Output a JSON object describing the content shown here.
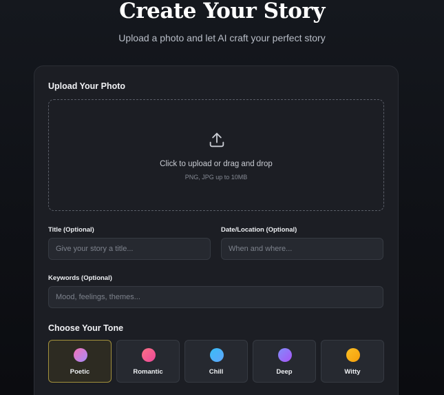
{
  "header": {
    "title": "Create Your Story",
    "subtitle": "Upload a photo and let AI craft your perfect story"
  },
  "upload": {
    "section_label": "Upload Your Photo",
    "icon": "upload-icon",
    "main_text": "Click to upload or drag and drop",
    "hint_text": "PNG, JPG up to 10MB"
  },
  "fields": {
    "title": {
      "label": "Title (Optional)",
      "placeholder": "Give your story a title...",
      "value": ""
    },
    "date_location": {
      "label": "Date/Location (Optional)",
      "placeholder": "When and where...",
      "value": ""
    },
    "keywords": {
      "label": "Keywords (Optional)",
      "placeholder": "Mood, feelings, themes...",
      "value": ""
    }
  },
  "tone": {
    "section_label": "Choose Your Tone",
    "selected": "Poetic",
    "options": [
      {
        "label": "Poetic",
        "colors": [
          "#f472b6",
          "#a78bfa"
        ]
      },
      {
        "label": "Romantic",
        "colors": [
          "#fb7185",
          "#ec4899"
        ]
      },
      {
        "label": "Chill",
        "colors": [
          "#38bdf8",
          "#60a5fa"
        ]
      },
      {
        "label": "Deep",
        "colors": [
          "#818cf8",
          "#a855f7"
        ]
      },
      {
        "label": "Witty",
        "colors": [
          "#fbbf24",
          "#f59e0b"
        ]
      }
    ]
  },
  "colors": {
    "background": "#0f1116",
    "card": "#1c1e24",
    "input": "#262930",
    "selected_border": "#a3913c"
  }
}
